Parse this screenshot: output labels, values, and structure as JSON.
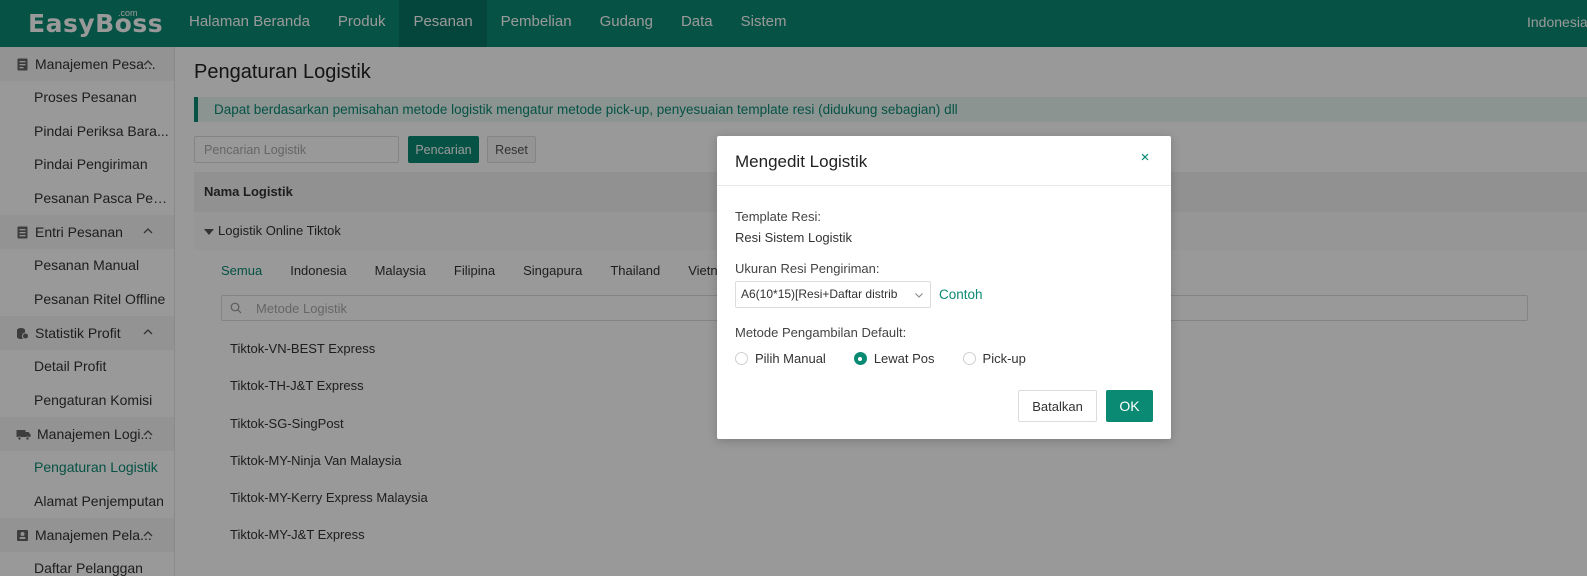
{
  "brand": {
    "logo": "EasyBoss",
    "logo_sup": ".com"
  },
  "nav": {
    "items": [
      "Halaman Beranda",
      "Produk",
      "Pesanan",
      "Pembelian",
      "Gudang",
      "Data",
      "Sistem"
    ],
    "active": "Pesanan",
    "right_text": "Indonesia"
  },
  "sidebar": {
    "groups": [
      {
        "label": "Manajemen Pesa...",
        "icon": "order-icon",
        "items": [
          "Proses Pesanan",
          "Pindai Periksa Bara...",
          "Pindai Pengiriman",
          "Pesanan Pasca Penj..."
        ]
      },
      {
        "label": "Entri Pesanan",
        "icon": "entry-icon",
        "items": [
          "Pesanan Manual",
          "Pesanan Ritel Offline"
        ]
      },
      {
        "label": "Statistik Profit",
        "icon": "coins-icon",
        "items": [
          "Detail Profit",
          "Pengaturan Komisi"
        ]
      },
      {
        "label": "Manajemen Logi...",
        "icon": "truck-icon",
        "items": [
          "Pengaturan Logistik",
          "Alamat Penjemputan"
        ]
      },
      {
        "label": "Manajemen Pela...",
        "icon": "customer-icon",
        "items": [
          "Daftar Pelanggan"
        ]
      }
    ],
    "active_item": "Pengaturan Logistik"
  },
  "main": {
    "title": "Pengaturan Logistik",
    "notice": "Dapat berdasarkan pemisahan metode logistik mengatur metode pick-up, penyesuaian template resi (didukung sebagian) dll",
    "search_placeholder": "Pencarian Logistik",
    "search_button": "Pencarian",
    "reset_button": "Reset",
    "table_header": "Nama Logistik",
    "group_label": "Logistik Online Tiktok",
    "country_tabs": [
      "Semua",
      "Indonesia",
      "Malaysia",
      "Filipina",
      "Singapura",
      "Thailand",
      "Vietnam"
    ],
    "active_tab": "Semua",
    "method_search_placeholder": "Metode Logistik",
    "methods": [
      "Tiktok-VN-BEST Express",
      "Tiktok-TH-J&T Express",
      "Tiktok-SG-SingPost",
      "Tiktok-MY-Ninja Van Malaysia",
      "Tiktok-MY-Kerry Express Malaysia",
      "Tiktok-MY-J&T Express"
    ]
  },
  "modal": {
    "title": "Mengedit Logistik",
    "template_label": "Template Resi",
    "template_value": "Resi Sistem Logistik",
    "size_label": "Ukuran Resi Pengiriman",
    "size_value": "A6(10*15)[Resi+Daftar distrib",
    "example_link": "Contoh",
    "method_label": "Metode Pengambilan Default",
    "radio_options": [
      "Pilih Manual",
      "Lewat Pos",
      "Pick-up"
    ],
    "radio_selected": "Lewat Pos",
    "cancel_button": "Batalkan",
    "ok_button": "OK"
  },
  "colors": {
    "primary": "#0a8a73",
    "overlay": "rgba(0,0,0,0.4)"
  }
}
